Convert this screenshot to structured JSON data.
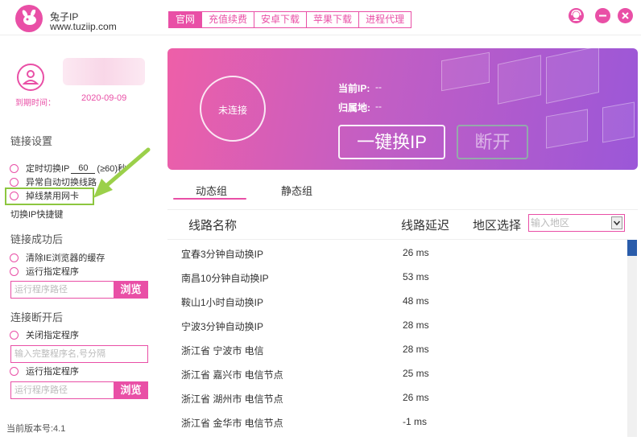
{
  "app": {
    "name": "兔子IP",
    "url": "www.tuziip.com"
  },
  "nav": {
    "items": [
      {
        "label": "官网",
        "active": true
      },
      {
        "label": "充值续费",
        "active": false
      },
      {
        "label": "安卓下载",
        "active": false
      },
      {
        "label": "苹果下载",
        "active": false
      },
      {
        "label": "进程代理",
        "active": false
      }
    ]
  },
  "user": {
    "expire_label": "到期时间：",
    "expire_date": "2020-09-09"
  },
  "link_settings": {
    "title": "链接设置",
    "timed_switch_label": "定时切换IP",
    "timed_switch_value": "60",
    "timed_switch_hint": "(≥60)秒",
    "auto_switch_label": "异常自动切换线路",
    "disable_nic_label": "掉线禁用网卡",
    "hotkey_label": "切换IP快捷键"
  },
  "on_success": {
    "title": "链接成功后",
    "clear_cache_label": "清除IE浏览器的缓存",
    "run_program_label": "运行指定程序",
    "path_placeholder": "运行程序路径",
    "browse_label": "浏览"
  },
  "on_disconnect": {
    "title": "连接断开后",
    "close_program_label": "关闭指定程序",
    "program_names_placeholder": "输入完整程序名,号分隔",
    "run_program_label": "运行指定程序",
    "path_placeholder": "运行程序路径",
    "browse_label": "浏览"
  },
  "version": "当前版本号:4.1",
  "banner": {
    "status": "未连接",
    "current_ip_label": "当前IP:",
    "current_ip_value": "--",
    "location_label": "归属地:",
    "location_value": "--",
    "switch_button": "一键换IP",
    "disconnect_button": "断开"
  },
  "tabs": [
    {
      "label": "动态组",
      "active": true
    },
    {
      "label": "静态组",
      "active": false
    }
  ],
  "table": {
    "headers": {
      "name": "线路名称",
      "delay": "线路延迟",
      "region": "地区选择"
    },
    "region_placeholder": "输入地区",
    "rows": [
      {
        "name": "宜春3分钟自动换IP",
        "delay": "26 ms"
      },
      {
        "name": "南昌10分钟自动换IP",
        "delay": "53 ms"
      },
      {
        "name": "鞍山1小时自动换IP",
        "delay": "48 ms"
      },
      {
        "name": "宁波3分钟自动换IP",
        "delay": "28 ms"
      },
      {
        "name": "浙江省 宁波市 电信",
        "delay": "28 ms"
      },
      {
        "name": "浙江省 嘉兴市 电信节点",
        "delay": "25 ms"
      },
      {
        "name": "浙江省 湖州市 电信节点",
        "delay": "26 ms"
      },
      {
        "name": "浙江省 金华市 电信节点",
        "delay": "-1 ms"
      }
    ]
  },
  "colors": {
    "accent": "#e94fa6",
    "highlight": "#8dc63f",
    "scrollbar_thumb": "#2a5caa"
  }
}
